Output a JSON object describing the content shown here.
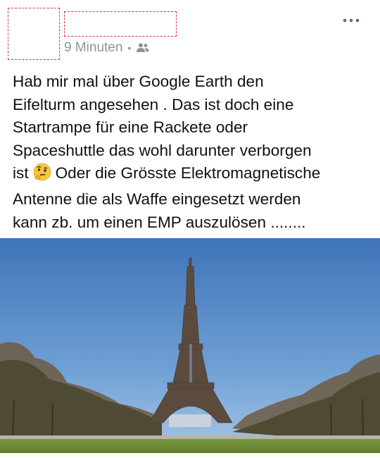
{
  "post": {
    "timestamp": "9 Minuten",
    "separator": "•",
    "audience_icon": "friends-icon",
    "more_icon": "more-horizontal-icon",
    "text_lines": [
      "Hab mir mal über Google Earth den",
      "Eifelturm angesehen . Das ist doch eine",
      "Startrampe für eine Rackete oder",
      "Spaceshuttle das wohl darunter verborgen",
      "ist",
      "Oder die Grösste Elektromagnetische",
      "Antenne die als Waffe eingesetzt werden",
      "kann zb. um einen EMP auszulösen  ........"
    ],
    "emoji": "thinking-face-emoji",
    "photo_subject": "eiffel-tower-photo"
  },
  "colors": {
    "meta_gray": "#8d949e",
    "redaction_border": "#d0343d",
    "sky": "#4f86c6",
    "lawn": "#6f8f3a"
  }
}
